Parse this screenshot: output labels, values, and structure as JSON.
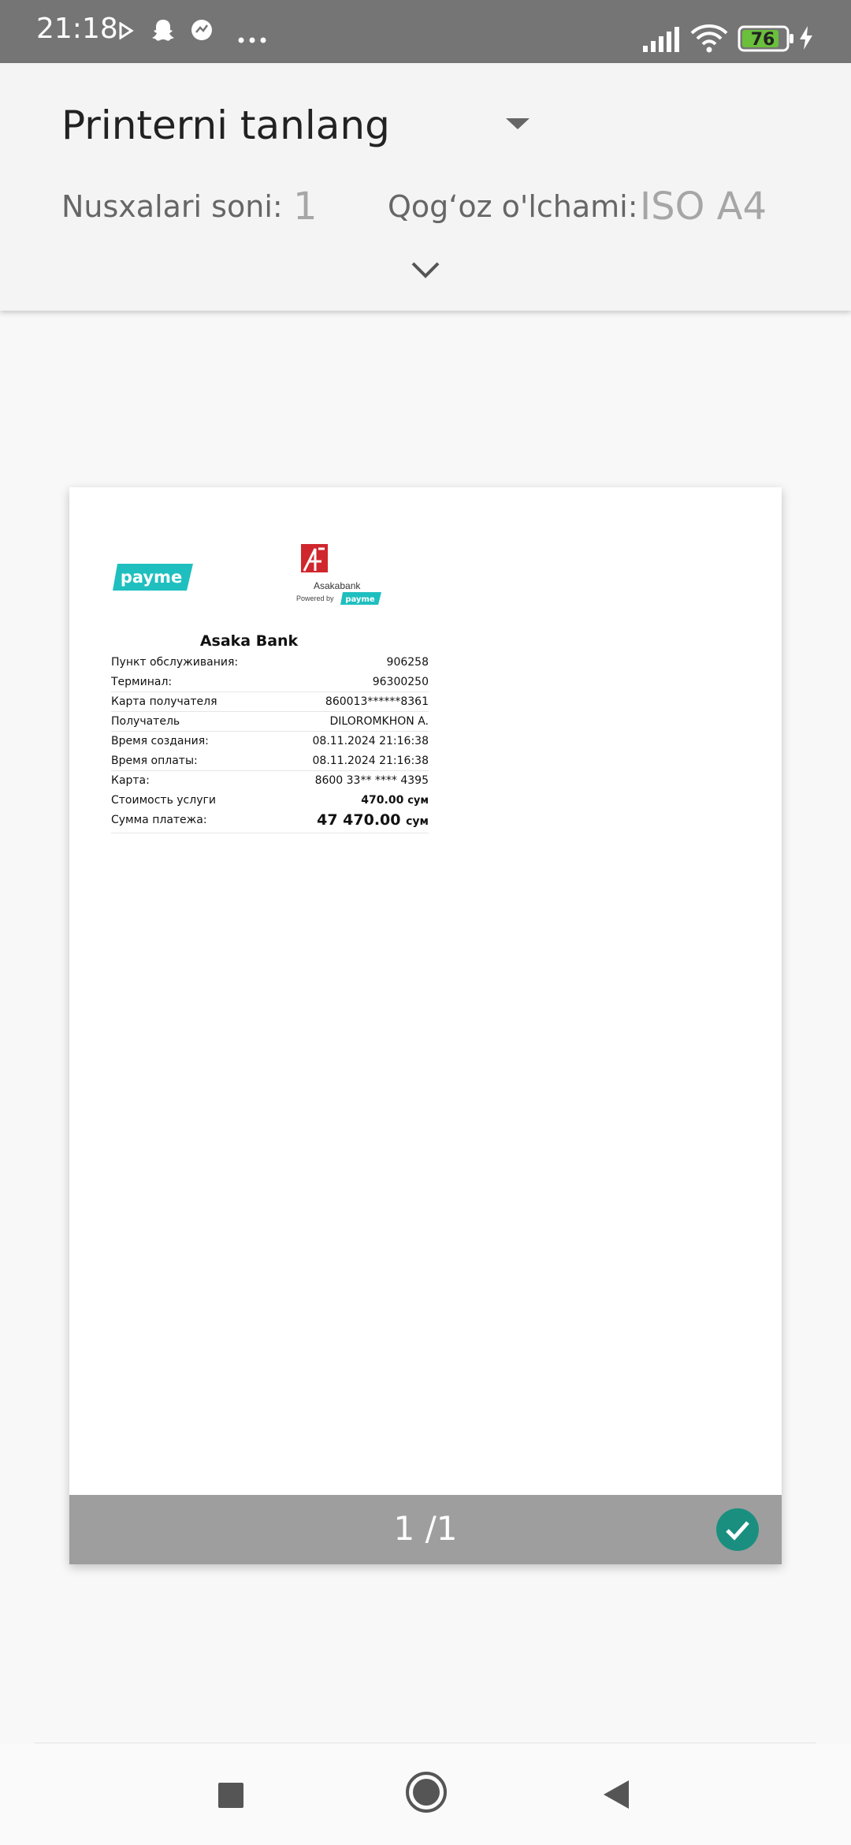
{
  "status_bar": {
    "time": "21:18",
    "battery": "76",
    "icons": [
      "play-store-icon",
      "snapchat-icon",
      "app-icon",
      "more-icon",
      "signal-icon",
      "wifi-icon",
      "battery-icon",
      "charging-icon"
    ]
  },
  "print_options": {
    "printer_label": "Printerni tanlang",
    "copies_label": "Nusxalari soni:",
    "copies_value": "1",
    "paper_label": "Qog‘oz o'lchami:",
    "paper_value": "ISO A4"
  },
  "preview": {
    "page_count": "1 /1",
    "receipt": {
      "payme_logo": "payme",
      "bank_logo_name": "Asakabank",
      "powered_by": "Powered by",
      "powered_payme": "payme",
      "title": "Asaka Bank",
      "rows": [
        {
          "label": "Пункт обслуживания:",
          "value": "906258"
        },
        {
          "label": "Терминал:",
          "value": "96300250"
        },
        {
          "label": "Карта получателя",
          "value": "860013******8361"
        },
        {
          "label": "Получатель",
          "value": "DILOROMKHON A."
        },
        {
          "label": "Время создания:",
          "value": "08.11.2024 21:16:38"
        },
        {
          "label": "Время оплаты:",
          "value": "08.11.2024 21:16:38"
        },
        {
          "label": "Карта:",
          "value": "8600 33** **** 4395"
        },
        {
          "label": "Стоимость услуги",
          "value": "470.00",
          "currency": "сум"
        },
        {
          "label": "Сумма платежа:",
          "value": "47 470.00",
          "currency": "сум"
        }
      ]
    }
  },
  "colors": {
    "status_bar": "#757575",
    "battery_fill": "#6abf3b",
    "accent_check": "#1a8f80",
    "payme": "#1fbfbf",
    "asaka_red": "#d0262d",
    "footer": "#9e9e9e"
  }
}
